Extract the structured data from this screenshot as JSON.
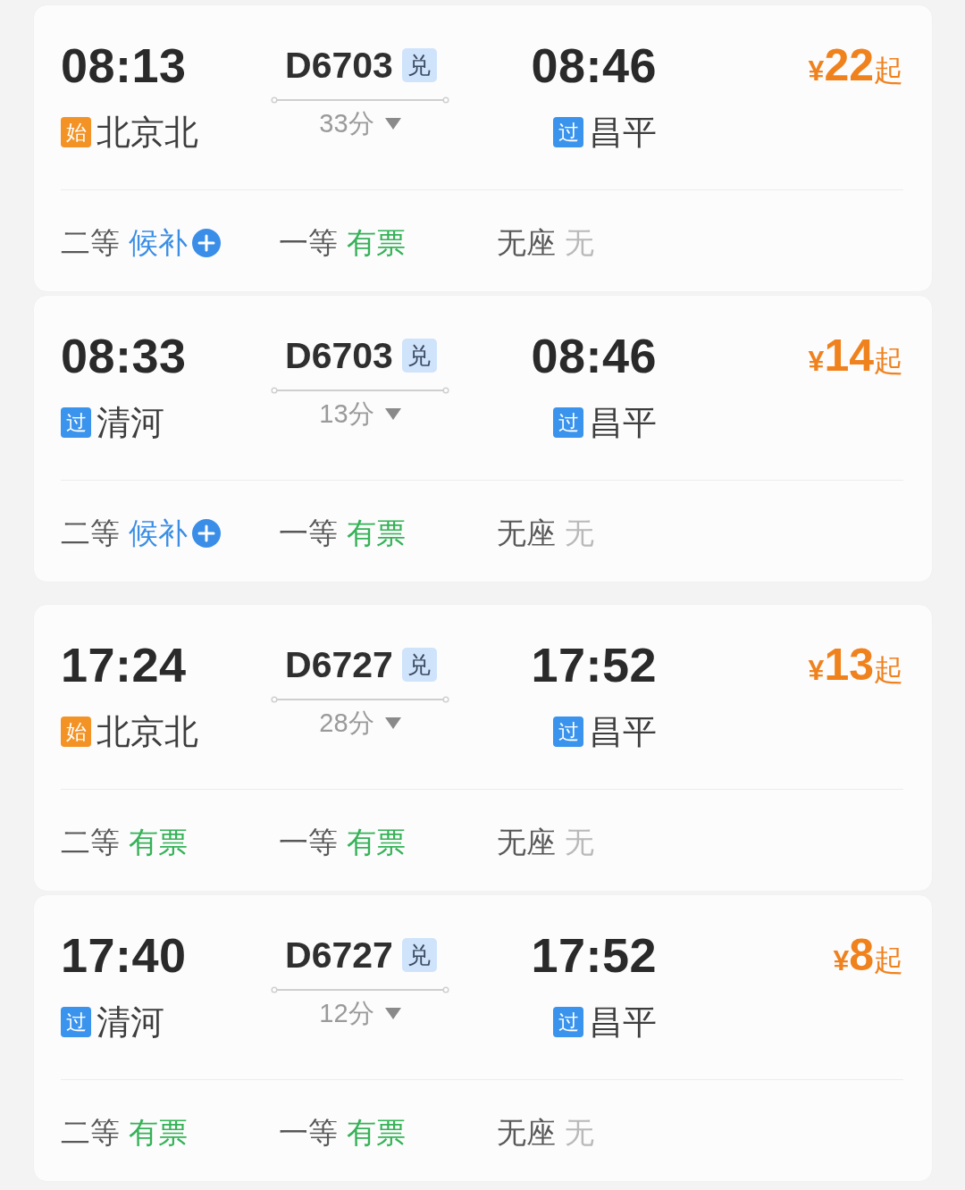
{
  "groups": [
    {
      "trains": [
        {
          "departure": {
            "time": "08:13",
            "tag": {
              "text": "始",
              "color": "#f39326"
            },
            "station": "北京北"
          },
          "train_no": "D6703",
          "badge": "兑",
          "duration": "33分",
          "arrival": {
            "time": "08:46",
            "tag": {
              "text": "过",
              "color": "#3a93ec"
            },
            "station": "昌平"
          },
          "price": {
            "currency": "¥",
            "amount": "22",
            "suffix": "起"
          },
          "seats": [
            {
              "class": "二等",
              "status": "候补",
              "kind": "waitlist"
            },
            {
              "class": "一等",
              "status": "有票",
              "kind": "available"
            },
            {
              "class": "无座",
              "status": "无",
              "kind": "none"
            }
          ]
        },
        {
          "departure": {
            "time": "08:33",
            "tag": {
              "text": "过",
              "color": "#3a93ec"
            },
            "station": "清河"
          },
          "train_no": "D6703",
          "badge": "兑",
          "duration": "13分",
          "arrival": {
            "time": "08:46",
            "tag": {
              "text": "过",
              "color": "#3a93ec"
            },
            "station": "昌平"
          },
          "price": {
            "currency": "¥",
            "amount": "14",
            "suffix": "起"
          },
          "seats": [
            {
              "class": "二等",
              "status": "候补",
              "kind": "waitlist"
            },
            {
              "class": "一等",
              "status": "有票",
              "kind": "available"
            },
            {
              "class": "无座",
              "status": "无",
              "kind": "none"
            }
          ]
        }
      ]
    },
    {
      "trains": [
        {
          "departure": {
            "time": "17:24",
            "tag": {
              "text": "始",
              "color": "#f39326"
            },
            "station": "北京北"
          },
          "train_no": "D6727",
          "badge": "兑",
          "duration": "28分",
          "arrival": {
            "time": "17:52",
            "tag": {
              "text": "过",
              "color": "#3a93ec"
            },
            "station": "昌平"
          },
          "price": {
            "currency": "¥",
            "amount": "13",
            "suffix": "起"
          },
          "seats": [
            {
              "class": "二等",
              "status": "有票",
              "kind": "available"
            },
            {
              "class": "一等",
              "status": "有票",
              "kind": "available"
            },
            {
              "class": "无座",
              "status": "无",
              "kind": "none"
            }
          ]
        },
        {
          "departure": {
            "time": "17:40",
            "tag": {
              "text": "过",
              "color": "#3a93ec"
            },
            "station": "清河"
          },
          "train_no": "D6727",
          "badge": "兑",
          "duration": "12分",
          "arrival": {
            "time": "17:52",
            "tag": {
              "text": "过",
              "color": "#3a93ec"
            },
            "station": "昌平"
          },
          "price": {
            "currency": "¥",
            "amount": "8",
            "suffix": "起"
          },
          "seats": [
            {
              "class": "二等",
              "status": "有票",
              "kind": "available"
            },
            {
              "class": "一等",
              "status": "有票",
              "kind": "available"
            },
            {
              "class": "无座",
              "status": "无",
              "kind": "none"
            }
          ]
        }
      ]
    }
  ]
}
